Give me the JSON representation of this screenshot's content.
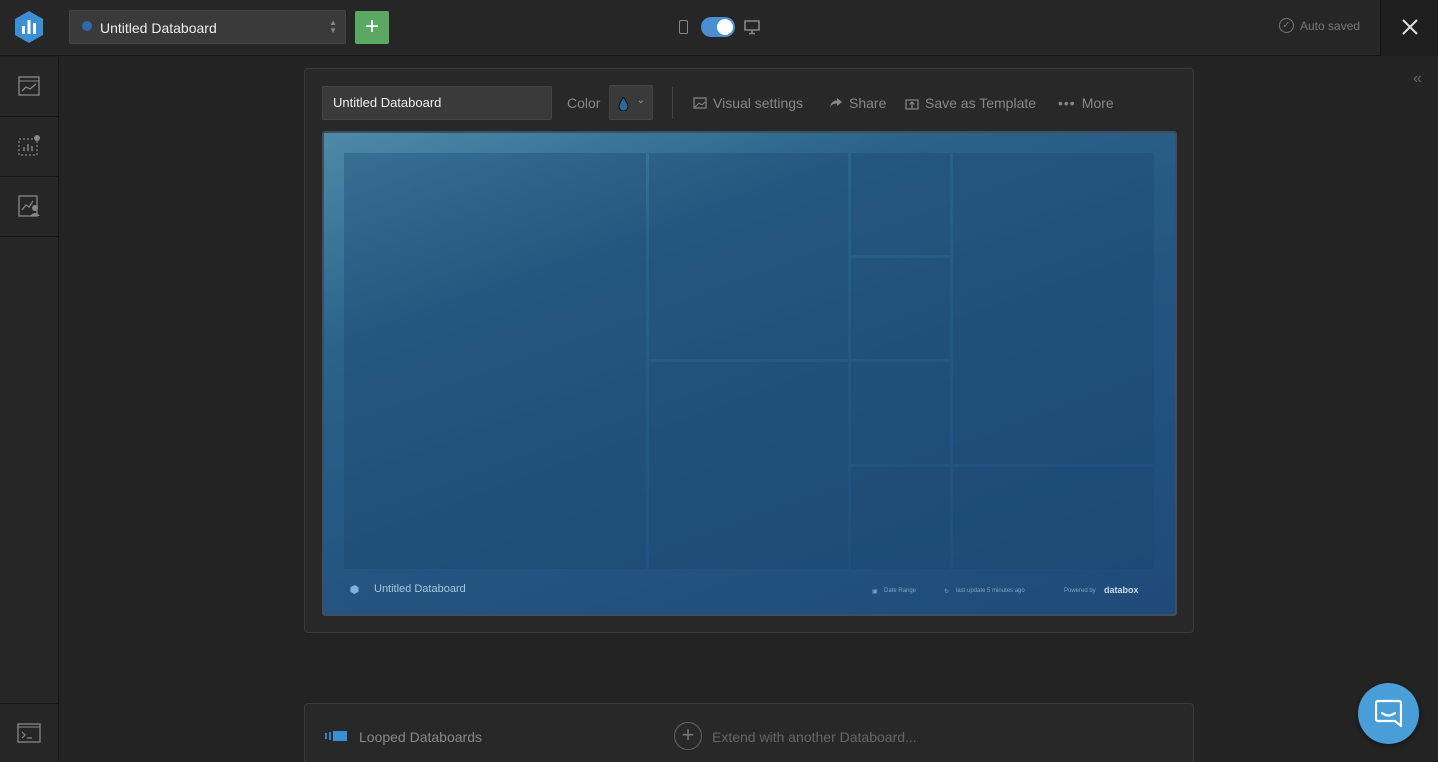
{
  "topbar": {
    "board_name": "Untitled Databoard",
    "add_label": "+",
    "autosave_text": "Auto saved",
    "icons": {
      "logo": "databox-logo-icon",
      "phone": "phone-icon",
      "desktop": "desktop-icon",
      "close": "close-icon",
      "check": "check-circle-icon"
    },
    "colors": {
      "accent_green": "#5aa862",
      "toggle_blue": "#4a8fd0",
      "dot_blue": "#2d6aa8"
    }
  },
  "sidebar": {
    "items": [
      {
        "icon": "metrics-library-icon"
      },
      {
        "icon": "add-datablock-icon"
      },
      {
        "icon": "user-metrics-icon"
      }
    ],
    "bottom_icon": "console-icon"
  },
  "editor": {
    "name_value": "Untitled Databoard",
    "color_label": "Color",
    "toolbar": {
      "visual_settings": "Visual settings",
      "share": "Share",
      "save_template": "Save as Template",
      "more": "More"
    },
    "preview": {
      "footer_title": "Untitled Databoard",
      "date_range": "Date Range",
      "last_update": "last update 5 minutes ago",
      "powered_by": "Powered by",
      "brand": "databox"
    }
  },
  "looped": {
    "label": "Looped Databoards",
    "extend": "Extend with another Databoard..."
  },
  "chat": {
    "icon": "chat-bubble-icon"
  }
}
